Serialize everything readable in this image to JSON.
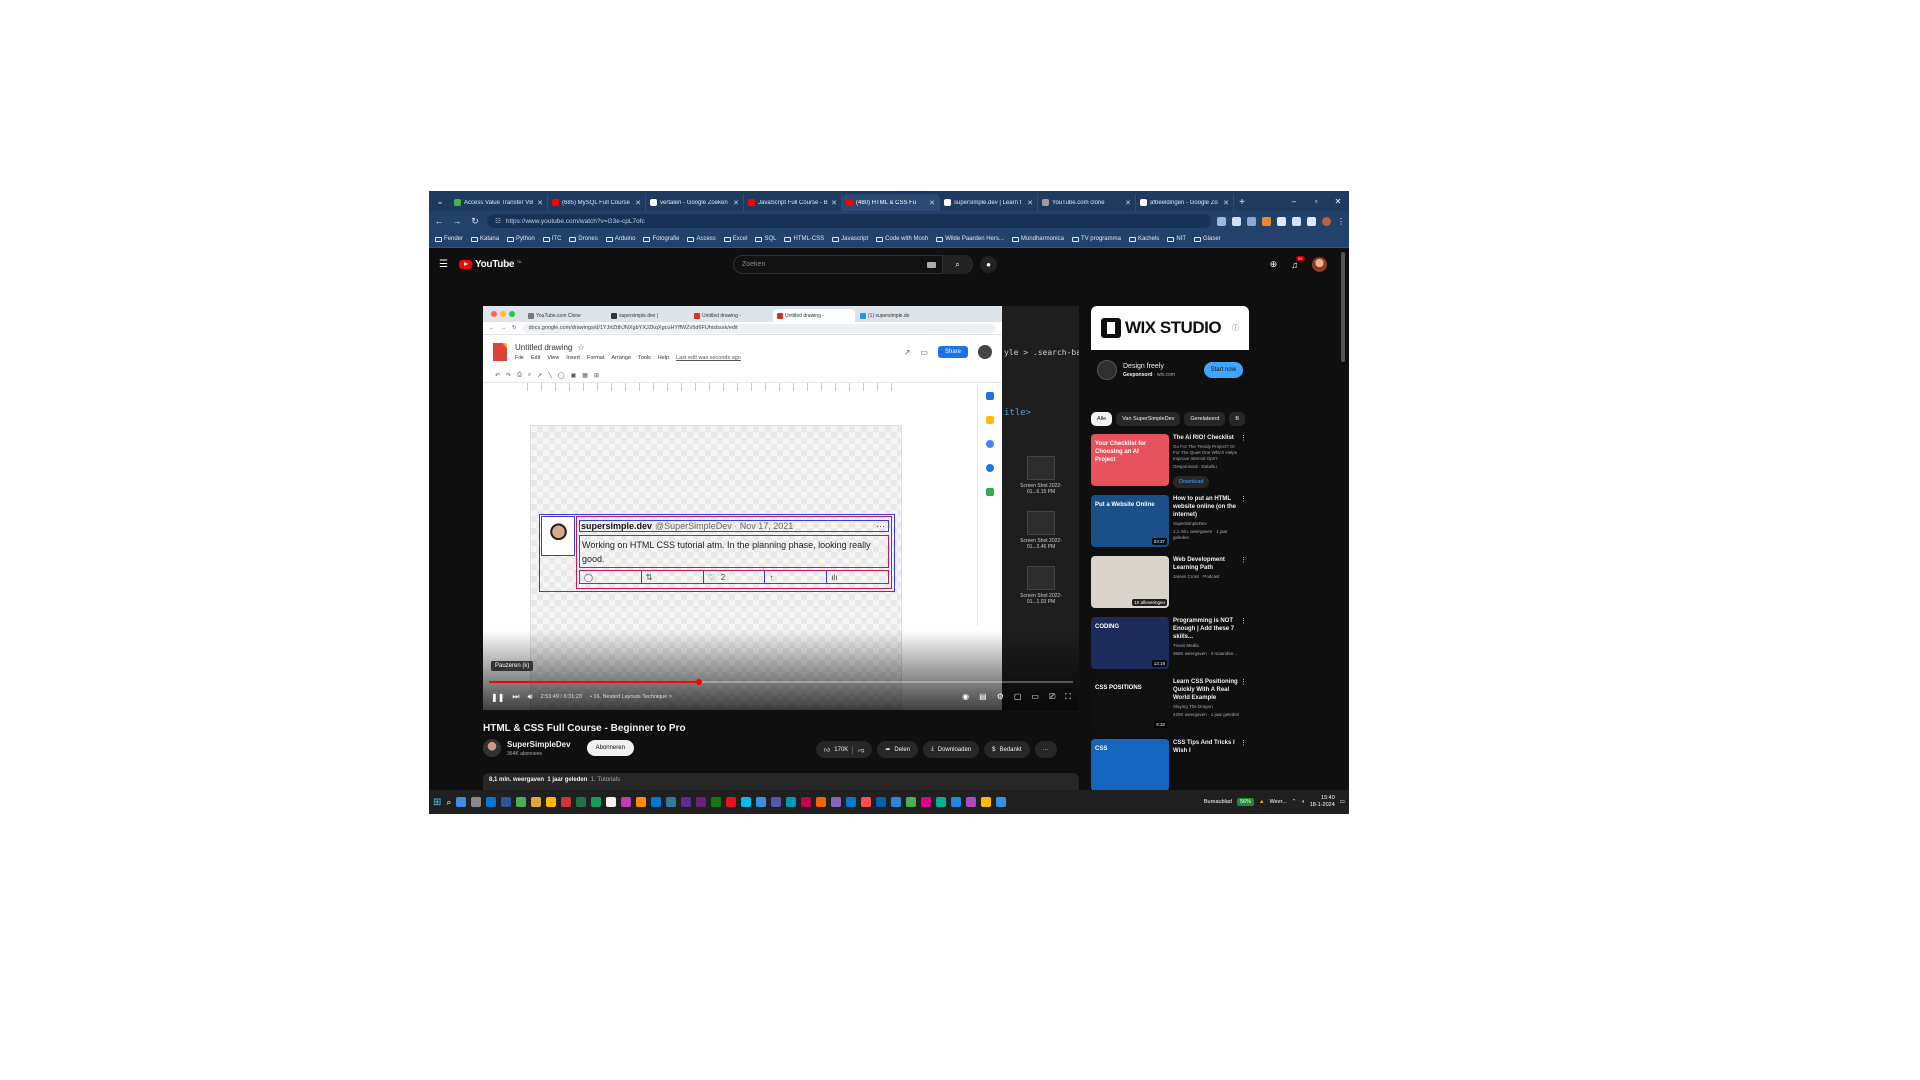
{
  "browser": {
    "tabs": [
      {
        "title": "Access Value Transfer VB",
        "color": "#4caf50"
      },
      {
        "title": "(685) MySQL Full Course",
        "color": "#ff0000"
      },
      {
        "title": "vertalen - Google Zoeken",
        "color": "#ffffff"
      },
      {
        "title": "JavaScript Full Course - B",
        "color": "#ff0000"
      },
      {
        "title": "(480) HTML & CSS Fu",
        "color": "#ff0000",
        "active": true
      },
      {
        "title": "supersimple.dev | Learn t",
        "color": "#ffffff"
      },
      {
        "title": "YouTube.com clone",
        "color": "#9e9e9e"
      },
      {
        "title": "afbeeldingen - Google Zo",
        "color": "#ffffff"
      }
    ],
    "url": "https://www.youtube.com/watch?v=G3e-cpL7ofc",
    "url_host": "youtube.com",
    "bookmarks": [
      "Fender",
      "Katana",
      "Python",
      "ITC",
      "Drones",
      "Arduino",
      "Fotografie",
      "Access",
      "Excel",
      "SQL",
      "HTML-CSS",
      "Javascript",
      "Code with Mosh",
      "Wilde Paarden Hers...",
      "Mondharmonica",
      "TV programma",
      "Kachels",
      "NIT",
      "Glaser"
    ]
  },
  "youtube": {
    "logo_text": "YouTube",
    "country_code": "NL",
    "search_placeholder": "Zoeken",
    "notification_count": "9+"
  },
  "player": {
    "inner_tabs": [
      "YouTube.com Clone",
      "supersimple.dev |",
      "Untitled drawing -",
      "Untitled drawing -",
      "(1) supersimple.de"
    ],
    "inner_url": "docs.google.com/drawings/d/1YJrtZtthJNXgbYXJZkqXgcuHYffWZv5d6FUhisbsxk/edit",
    "drawing_title": "Untitled drawing",
    "drawing_menu": [
      "File",
      "Edit",
      "View",
      "Insert",
      "Format",
      "Arrange",
      "Tools",
      "Help"
    ],
    "last_edit": "Last edit was seconds ago",
    "share_label": "Share",
    "tweet_name": "supersimple.dev",
    "tweet_handle": "@SuperSimpleDev · Nov 17, 2021",
    "tweet_more": "···",
    "tweet_text": "Working on HTML CSS tutorial atm. In the planning phase, looking really good.",
    "tweet_like_count": "2",
    "code_line1": "yle > .search-ba",
    "code_line2": "itle>",
    "screenshots": [
      "Screen Shot 2022-01...6.15 PM",
      "Screen Shot 2022-01...3.46 PM",
      "Screen Shot 2022-01...1.03 PM"
    ],
    "tooltip": "Pauzeren (k)",
    "progress": 0.36,
    "time": "2:53:49 / 6:31:23",
    "chapter": "• 16. Nested Layouts Technique >"
  },
  "video": {
    "title": "HTML & CSS Full Course - Beginner to Pro",
    "channel": "SuperSimpleDev",
    "subscribers": "364K abonnees",
    "subscribe_label": "Abonneren",
    "likes": "170K",
    "share_label": "Delen",
    "download_label": "Downloaden",
    "thanks_label": "Bedankt",
    "views": "8,1 mln. weergaven",
    "age": "1 jaar geleden",
    "tags": "1. Tutorials"
  },
  "sidebar": {
    "ad_banner": "WIX STUDIO",
    "ad_title": "Design freely",
    "ad_sponsor_label": "Gesponsord",
    "ad_domain": "wix.com",
    "ad_button": "Start now",
    "chips": [
      "Alle",
      "Van SuperSimpleDev",
      "Gerelateerd",
      "B"
    ],
    "recs": [
      {
        "title": "The AI RIO! Checklist",
        "meta": "Go For The Trendy Project? Or For The Quiet One Which Helps Improve Internal Ops?",
        "channel": "Gesponsord · Dataiku",
        "download": "Download",
        "thumb_text": "Your Checklist for Choosing an AI Project",
        "bg": "#e8525f"
      },
      {
        "title": "How to put an HTML website online (on the internet)",
        "meta": "SuperSimpleDev",
        "channel": "1,1 mln. weergaven · 1 jaar geleden",
        "duration": "23:37",
        "thumb_text": "Put a Website Online",
        "bg": "#1a4f8a"
      },
      {
        "title": "Web Development Learning Path",
        "meta": "James Cross · Podcast",
        "channel": "",
        "duration": "10 afleveringen",
        "thumb_text": "",
        "bg": "#d9d3cc"
      },
      {
        "title": "Programming is NOT Enough | Add these 7 skills...",
        "meta": "Travis Media",
        "channel": "368K weergaven · 3 maanden...",
        "duration": "13:19",
        "thumb_text": "CODING",
        "bg": "#1d2b5c"
      },
      {
        "title": "Learn CSS Positioning Quickly With A Real World Example",
        "meta": "Slaying The Dragon",
        "channel": "425K weergaven · 1 jaar geleden",
        "duration": "8:32",
        "thumb_text": "CSS POSITIONS",
        "bg": "#111111"
      },
      {
        "title": "CSS Tips And Tricks I Wish I",
        "meta": "",
        "channel": "",
        "duration": "",
        "thumb_text": "CSS",
        "bg": "#1565c0"
      }
    ]
  },
  "taskbar": {
    "weather": "Weer...",
    "battery": "56%",
    "time": "15:40",
    "date": "18-1-2024",
    "lang": "Bureaublad"
  }
}
